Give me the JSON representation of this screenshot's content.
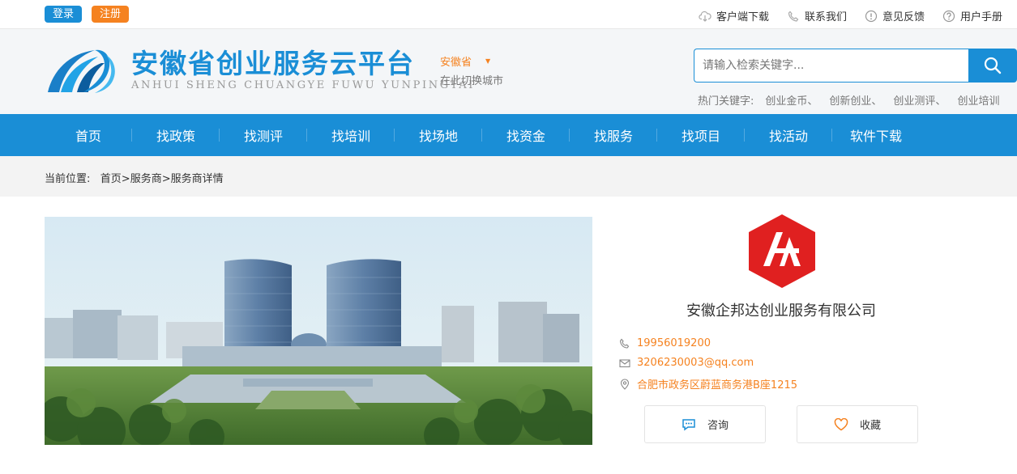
{
  "auth": {
    "login": "登录",
    "register": "注册"
  },
  "toplinks": [
    {
      "label": "客户端下载",
      "icon": "cloud-download-icon"
    },
    {
      "label": "联系我们",
      "icon": "phone-icon"
    },
    {
      "label": "意见反馈",
      "icon": "alert-circle-icon"
    },
    {
      "label": "用户手册",
      "icon": "help-circle-icon"
    }
  ],
  "header": {
    "title": "安徽省创业服务云平台",
    "subtitle": "ANHUI SHENG CHUANGYE FUWU YUNPINGTAI",
    "city": "安徽省",
    "city_hint": "在此切换城市",
    "search_placeholder": "请输入检索关键字...",
    "hot_label": "热门关键字:",
    "hot_words": [
      "创业金币、",
      "创新创业、",
      "创业测评、",
      "创业培训"
    ]
  },
  "nav": [
    "首页",
    "找政策",
    "找测评",
    "找培训",
    "找场地",
    "找资金",
    "找服务",
    "找项目",
    "找活动",
    "软件下载"
  ],
  "breadcrumb": {
    "label": "当前位置:",
    "path": "首页>服务商>服务商详情"
  },
  "company": {
    "name": "安徽企邦达创业服务有限公司",
    "phone": "19956019200",
    "email": "3206230003@qq.com",
    "address": "合肥市政务区蔚蓝商务港B座1215"
  },
  "actions": {
    "consult": "咨询",
    "favorite": "收藏"
  },
  "colors": {
    "primary": "#1a8ed6",
    "accent": "#f58220",
    "logo_red": "#e02020"
  }
}
